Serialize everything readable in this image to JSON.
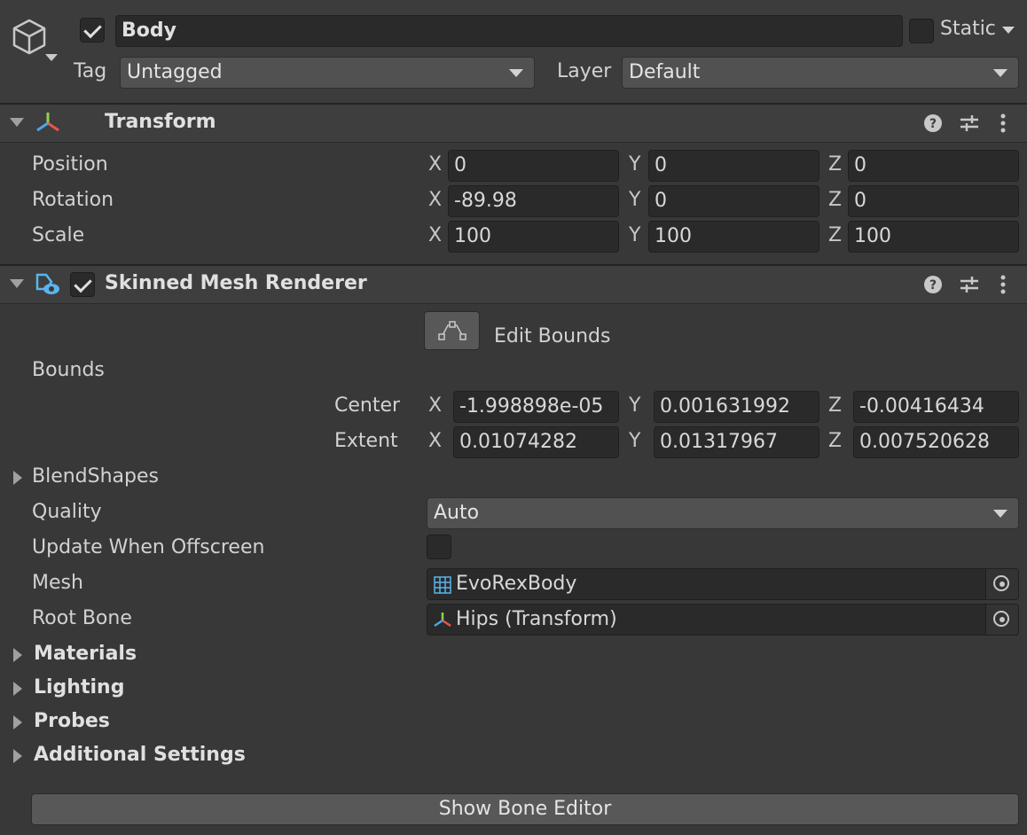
{
  "gameobject": {
    "name": "Body",
    "active": true,
    "static_label": "Static",
    "tag_label": "Tag",
    "tag_value": "Untagged",
    "layer_label": "Layer",
    "layer_value": "Default"
  },
  "transform": {
    "title": "Transform",
    "position_label": "Position",
    "rotation_label": "Rotation",
    "scale_label": "Scale",
    "axis_x": "X",
    "axis_y": "Y",
    "axis_z": "Z",
    "position": {
      "x": "0",
      "y": "0",
      "z": "0"
    },
    "rotation": {
      "x": "-89.98",
      "y": "0",
      "z": "0"
    },
    "scale": {
      "x": "100",
      "y": "100",
      "z": "100"
    }
  },
  "skinned": {
    "title": "Skinned Mesh Renderer",
    "enabled": true,
    "edit_bounds_label": "Edit Bounds",
    "bounds_label": "Bounds",
    "center_label": "Center",
    "extent_label": "Extent",
    "center": {
      "x": "-1.998898e-05",
      "y": "0.001631992",
      "z": "-0.00416434"
    },
    "extent": {
      "x": "0.01074282",
      "y": "0.01317967",
      "z": "0.007520628"
    },
    "blendshapes_label": "BlendShapes",
    "quality_label": "Quality",
    "quality_value": "Auto",
    "update_offscreen_label": "Update When Offscreen",
    "mesh_label": "Mesh",
    "mesh_value": "EvoRexBody",
    "root_bone_label": "Root Bone",
    "root_bone_value": "Hips (Transform)",
    "materials_label": "Materials",
    "lighting_label": "Lighting",
    "probes_label": "Probes",
    "additional_label": "Additional Settings"
  },
  "show_bone_editor_label": "Show Bone Editor",
  "icons": [
    "cube-icon",
    "transform-axes-icon",
    "help-icon",
    "preset-icon",
    "more-menu-icon",
    "skinned-mesh-icon",
    "edit-bounds-icon",
    "mesh-grid-icon",
    "object-picker-icon"
  ],
  "colors": {
    "background": "#383838",
    "field": "#2a2a2a",
    "header": "#3e3e3e",
    "axis_red": "#e8554a",
    "axis_green": "#8dd14b",
    "axis_blue": "#4aa8e8"
  }
}
